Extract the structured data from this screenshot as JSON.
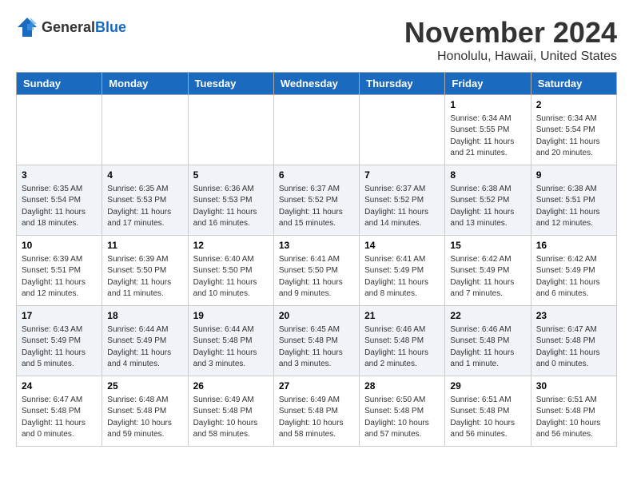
{
  "logo": {
    "text_general": "General",
    "text_blue": "Blue"
  },
  "header": {
    "month": "November 2024",
    "location": "Honolulu, Hawaii, United States"
  },
  "weekdays": [
    "Sunday",
    "Monday",
    "Tuesday",
    "Wednesday",
    "Thursday",
    "Friday",
    "Saturday"
  ],
  "weeks": [
    [
      {
        "day": "",
        "info": ""
      },
      {
        "day": "",
        "info": ""
      },
      {
        "day": "",
        "info": ""
      },
      {
        "day": "",
        "info": ""
      },
      {
        "day": "",
        "info": ""
      },
      {
        "day": "1",
        "info": "Sunrise: 6:34 AM\nSunset: 5:55 PM\nDaylight: 11 hours and 21 minutes."
      },
      {
        "day": "2",
        "info": "Sunrise: 6:34 AM\nSunset: 5:54 PM\nDaylight: 11 hours and 20 minutes."
      }
    ],
    [
      {
        "day": "3",
        "info": "Sunrise: 6:35 AM\nSunset: 5:54 PM\nDaylight: 11 hours and 18 minutes."
      },
      {
        "day": "4",
        "info": "Sunrise: 6:35 AM\nSunset: 5:53 PM\nDaylight: 11 hours and 17 minutes."
      },
      {
        "day": "5",
        "info": "Sunrise: 6:36 AM\nSunset: 5:53 PM\nDaylight: 11 hours and 16 minutes."
      },
      {
        "day": "6",
        "info": "Sunrise: 6:37 AM\nSunset: 5:52 PM\nDaylight: 11 hours and 15 minutes."
      },
      {
        "day": "7",
        "info": "Sunrise: 6:37 AM\nSunset: 5:52 PM\nDaylight: 11 hours and 14 minutes."
      },
      {
        "day": "8",
        "info": "Sunrise: 6:38 AM\nSunset: 5:52 PM\nDaylight: 11 hours and 13 minutes."
      },
      {
        "day": "9",
        "info": "Sunrise: 6:38 AM\nSunset: 5:51 PM\nDaylight: 11 hours and 12 minutes."
      }
    ],
    [
      {
        "day": "10",
        "info": "Sunrise: 6:39 AM\nSunset: 5:51 PM\nDaylight: 11 hours and 12 minutes."
      },
      {
        "day": "11",
        "info": "Sunrise: 6:39 AM\nSunset: 5:50 PM\nDaylight: 11 hours and 11 minutes."
      },
      {
        "day": "12",
        "info": "Sunrise: 6:40 AM\nSunset: 5:50 PM\nDaylight: 11 hours and 10 minutes."
      },
      {
        "day": "13",
        "info": "Sunrise: 6:41 AM\nSunset: 5:50 PM\nDaylight: 11 hours and 9 minutes."
      },
      {
        "day": "14",
        "info": "Sunrise: 6:41 AM\nSunset: 5:49 PM\nDaylight: 11 hours and 8 minutes."
      },
      {
        "day": "15",
        "info": "Sunrise: 6:42 AM\nSunset: 5:49 PM\nDaylight: 11 hours and 7 minutes."
      },
      {
        "day": "16",
        "info": "Sunrise: 6:42 AM\nSunset: 5:49 PM\nDaylight: 11 hours and 6 minutes."
      }
    ],
    [
      {
        "day": "17",
        "info": "Sunrise: 6:43 AM\nSunset: 5:49 PM\nDaylight: 11 hours and 5 minutes."
      },
      {
        "day": "18",
        "info": "Sunrise: 6:44 AM\nSunset: 5:49 PM\nDaylight: 11 hours and 4 minutes."
      },
      {
        "day": "19",
        "info": "Sunrise: 6:44 AM\nSunset: 5:48 PM\nDaylight: 11 hours and 3 minutes."
      },
      {
        "day": "20",
        "info": "Sunrise: 6:45 AM\nSunset: 5:48 PM\nDaylight: 11 hours and 3 minutes."
      },
      {
        "day": "21",
        "info": "Sunrise: 6:46 AM\nSunset: 5:48 PM\nDaylight: 11 hours and 2 minutes."
      },
      {
        "day": "22",
        "info": "Sunrise: 6:46 AM\nSunset: 5:48 PM\nDaylight: 11 hours and 1 minute."
      },
      {
        "day": "23",
        "info": "Sunrise: 6:47 AM\nSunset: 5:48 PM\nDaylight: 11 hours and 0 minutes."
      }
    ],
    [
      {
        "day": "24",
        "info": "Sunrise: 6:47 AM\nSunset: 5:48 PM\nDaylight: 11 hours and 0 minutes."
      },
      {
        "day": "25",
        "info": "Sunrise: 6:48 AM\nSunset: 5:48 PM\nDaylight: 10 hours and 59 minutes."
      },
      {
        "day": "26",
        "info": "Sunrise: 6:49 AM\nSunset: 5:48 PM\nDaylight: 10 hours and 58 minutes."
      },
      {
        "day": "27",
        "info": "Sunrise: 6:49 AM\nSunset: 5:48 PM\nDaylight: 10 hours and 58 minutes."
      },
      {
        "day": "28",
        "info": "Sunrise: 6:50 AM\nSunset: 5:48 PM\nDaylight: 10 hours and 57 minutes."
      },
      {
        "day": "29",
        "info": "Sunrise: 6:51 AM\nSunset: 5:48 PM\nDaylight: 10 hours and 56 minutes."
      },
      {
        "day": "30",
        "info": "Sunrise: 6:51 AM\nSunset: 5:48 PM\nDaylight: 10 hours and 56 minutes."
      }
    ]
  ]
}
